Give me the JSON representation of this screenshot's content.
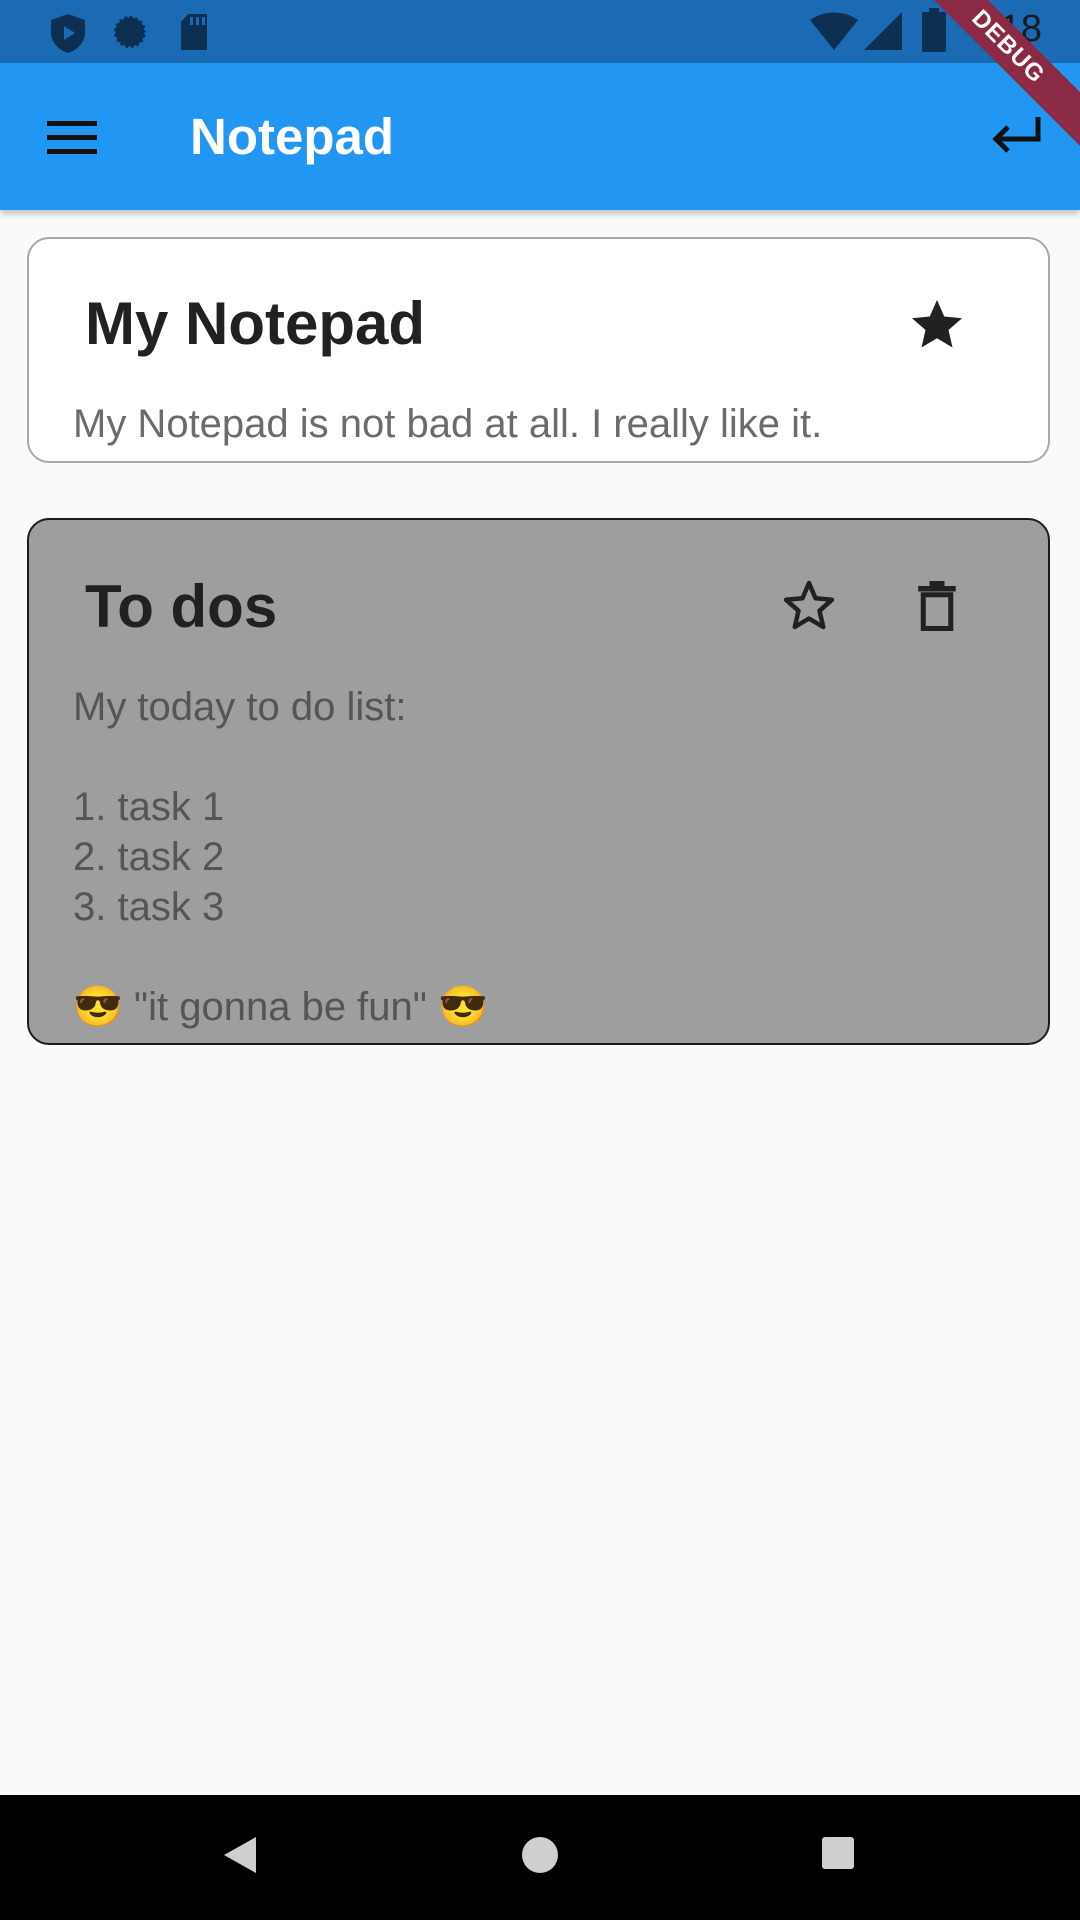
{
  "status_bar": {
    "time": "7:18",
    "icons": [
      "shield-icon",
      "sync-icon",
      "sd-card-icon",
      "wifi-icon",
      "signal-icon",
      "battery-icon"
    ]
  },
  "app_bar": {
    "title": "Notepad",
    "menu_icon": "menu-icon",
    "action_icon": "keyboard-return-icon",
    "color": "#2196f3"
  },
  "debug_banner": "DEBUG",
  "notes": [
    {
      "title": "My Notepad",
      "body": "My Notepad is not bad at all. I really like it.",
      "favorite": true,
      "star_icon": "star-filled-icon"
    },
    {
      "title": "To dos",
      "body": "My today to do list:\n\n1. task 1\n2. task 2\n3. task 3\n\n😎 \"it gonna be fun\" 😎",
      "favorite": false,
      "star_icon": "star-outline-icon",
      "delete_icon": "delete-icon",
      "background": "#9e9e9e"
    }
  ],
  "nav_bar": {
    "icons": [
      "back-icon",
      "home-icon",
      "recents-icon"
    ]
  }
}
